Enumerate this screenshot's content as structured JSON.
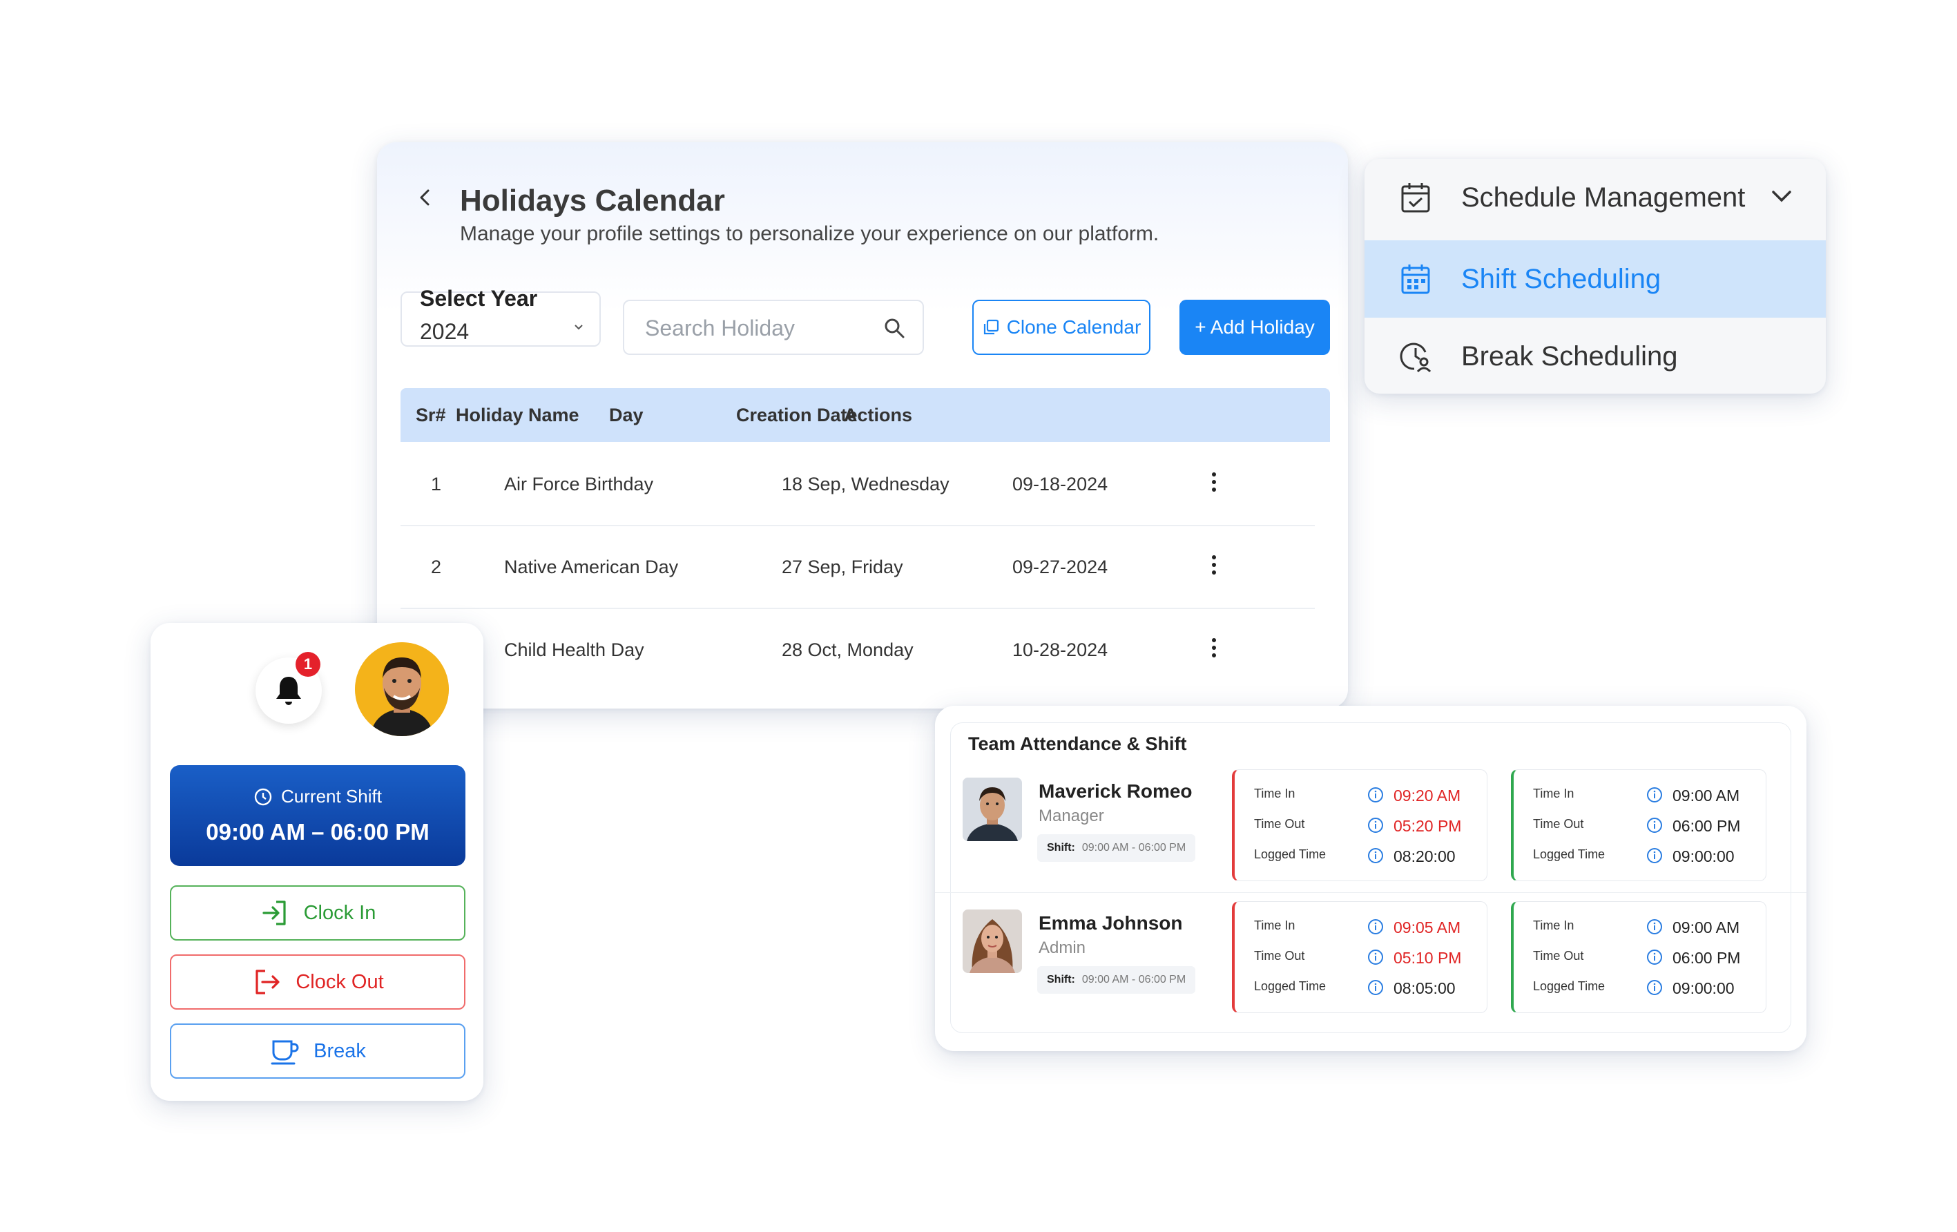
{
  "holidays": {
    "title": "Holidays Calendar",
    "subtitle": "Manage your profile settings to personalize your experience on our platform.",
    "year_label": "Select Year",
    "year_value": "2024",
    "search_placeholder": "Search Holiday",
    "clone_label": "Clone Calendar",
    "add_label": "+ Add Holiday",
    "columns": [
      "Sr#",
      "Holiday Name",
      "Day",
      "Creation Date",
      "Actions"
    ],
    "rows": [
      {
        "sr": "1",
        "name": "Air Force Birthday",
        "day": "18 Sep, Wednesday",
        "date": "09-18-2024"
      },
      {
        "sr": "2",
        "name": "Native American Day",
        "day": "27 Sep, Friday",
        "date": "09-27-2024"
      },
      {
        "sr": "",
        "name": "Child Health Day",
        "day": "28 Oct, Monday",
        "date": "10-28-2024"
      }
    ]
  },
  "schedule": {
    "header": "Schedule Management",
    "items": [
      {
        "label": "Shift Scheduling",
        "icon": "calendar-grid-icon",
        "active": true
      },
      {
        "label": "Break Scheduling",
        "icon": "clock-user-icon",
        "active": false
      }
    ],
    "colors": {
      "active_bg": "#cfe4fb",
      "active_text": "#1a85f5"
    }
  },
  "clock": {
    "notification_count": "1",
    "current_shift_label": "Current Shift",
    "current_shift_time": "09:00 AM – 06:00 PM",
    "clock_in": "Clock In",
    "clock_out": "Clock Out",
    "break": "Break"
  },
  "team": {
    "title": "Team Attendance & Shift",
    "shift_label": "Shift:",
    "members": [
      {
        "name": "Maverick Romeo",
        "role": "Manager",
        "shift": "09:00 AM - 06:00 PM",
        "actual": {
          "time_in": "09:20 AM",
          "time_out": "05:20 PM",
          "logged": "08:20:00"
        },
        "scheduled": {
          "time_in": "09:00 AM",
          "time_out": "06:00 PM",
          "logged": "09:00:00"
        }
      },
      {
        "name": "Emma Johnson",
        "role": "Admin",
        "shift": "09:00 AM - 06:00 PM",
        "actual": {
          "time_in": "09:05 AM",
          "time_out": "05:10 PM",
          "logged": "08:05:00"
        },
        "scheduled": {
          "time_in": "09:00 AM",
          "time_out": "06:00 PM",
          "logged": "09:00:00"
        }
      }
    ],
    "labels": {
      "time_in": "Time In",
      "time_out": "Time Out",
      "logged": "Logged Time"
    },
    "colors": {
      "late": "#e02424",
      "ok": "#2fa84f"
    }
  }
}
